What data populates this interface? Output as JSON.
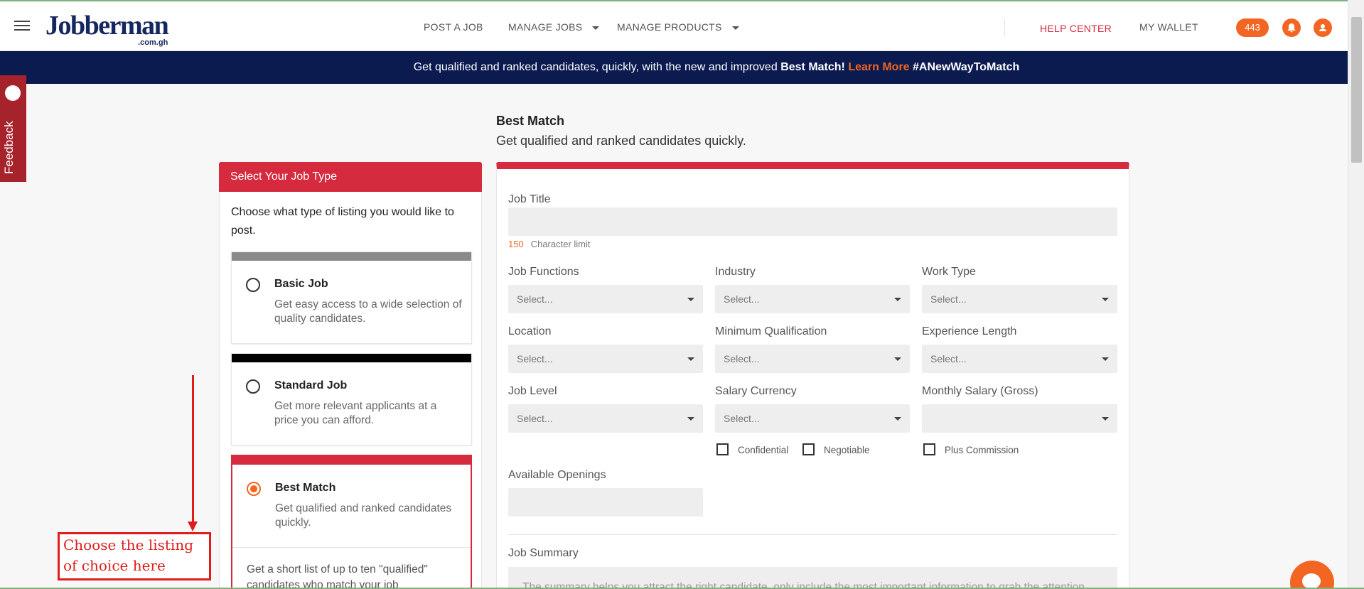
{
  "header": {
    "logo_text": "Jobberman",
    "logo_sub": ".com.gh",
    "nav": [
      "POST A JOB",
      "MANAGE JOBS",
      "MANAGE PRODUCTS"
    ],
    "help_center": "HELP CENTER",
    "wallet": "MY WALLET",
    "count_badge": "443"
  },
  "banner": {
    "text": "Get qualified and ranked candidates, quickly, with the new and improved",
    "bold": "Best Match!",
    "link": "Learn More",
    "hashtag": "#ANewWayToMatch"
  },
  "feedback": "Feedback",
  "left": {
    "heading": "Select Your Job Type",
    "intro": "Choose what type of listing you would like to post.",
    "cards": [
      {
        "title": "Basic Job",
        "desc": "Get easy access to a wide selection of quality candidates.",
        "bar_color": "#8a8a8a"
      },
      {
        "title": "Standard Job",
        "desc": "Get more relevant applicants at a price you can afford.",
        "bar_color": "#000000"
      },
      {
        "title": "Best Match",
        "desc": "Get qualified and ranked candidates quickly.",
        "bar_color": "#d62b3f",
        "extra": "Get a short list of up to ten \"qualified\" candidates who match your job"
      }
    ]
  },
  "annotation": "Choose the listing of choice here",
  "main": {
    "title": "Best Match",
    "subtitle": "Get qualified and ranked candidates quickly.",
    "job_title_label": "Job Title",
    "char_limit_num": "150",
    "char_limit_text": "Character limit",
    "select_placeholder": "Select...",
    "fields": {
      "job_functions": "Job Functions",
      "industry": "Industry",
      "work_type": "Work Type",
      "location": "Location",
      "min_qualification": "Minimum Qualification",
      "experience_length": "Experience Length",
      "job_level": "Job Level",
      "salary_currency": "Salary Currency",
      "monthly_salary": "Monthly Salary (Gross)",
      "available_openings": "Available Openings",
      "job_summary": "Job Summary"
    },
    "checkboxes": {
      "confidential": "Confidential",
      "negotiable": "Negotiable",
      "plus_commission": "Plus Commission"
    },
    "summary_placeholder": "The summary helps you attract the right candidate, only include the most important information to grab the attention"
  },
  "colors": {
    "brand_red": "#d62b3f",
    "accent_orange": "#f26522",
    "navy": "#0b1a4f"
  }
}
